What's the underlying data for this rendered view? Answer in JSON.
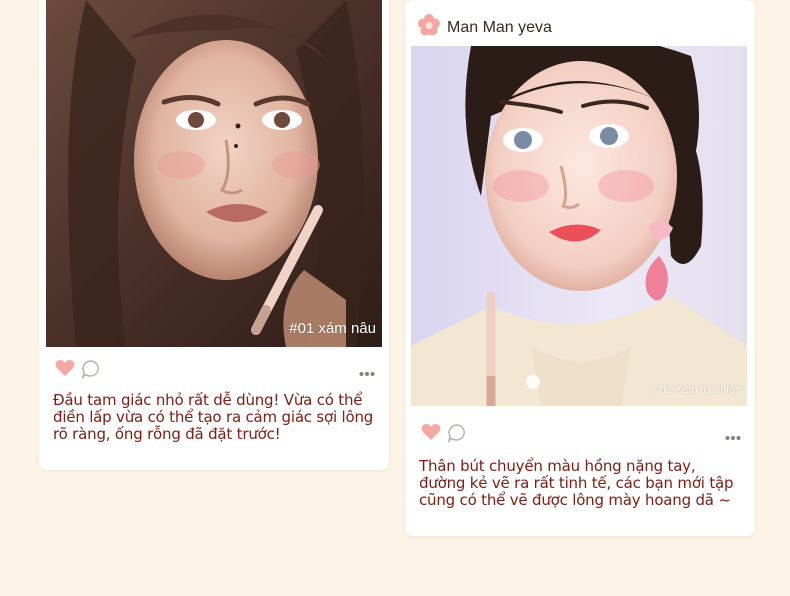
{
  "posts": [
    {
      "photo_caption": "#01 xám nâu",
      "text": "Đầu tam giác nhỏ rất dễ dùng! Vừa có thể điền lấp vừa có thể tạo ra cảm giác sợi lông rõ ràng, ống rỗng đã đặt trước!"
    },
    {
      "username": "Man Man yeva",
      "photo_caption": "#02 Xám tự nhiên",
      "text": "Thân bút chuyển màu hồng nặng tay, đường kẻ vẽ ra rất tinh tế, các bạn mới tập cũng có thể vẽ được lông mày hoang dã ~"
    }
  ],
  "icons": {
    "avatar": "flower-icon",
    "like": "heart-icon",
    "comment": "comment-icon",
    "more": "more-icon"
  },
  "colors": {
    "background": "#fdf3e7",
    "text": "#7a2016",
    "heart": "#f4a6a3",
    "avatar": "#f4a6a3"
  }
}
